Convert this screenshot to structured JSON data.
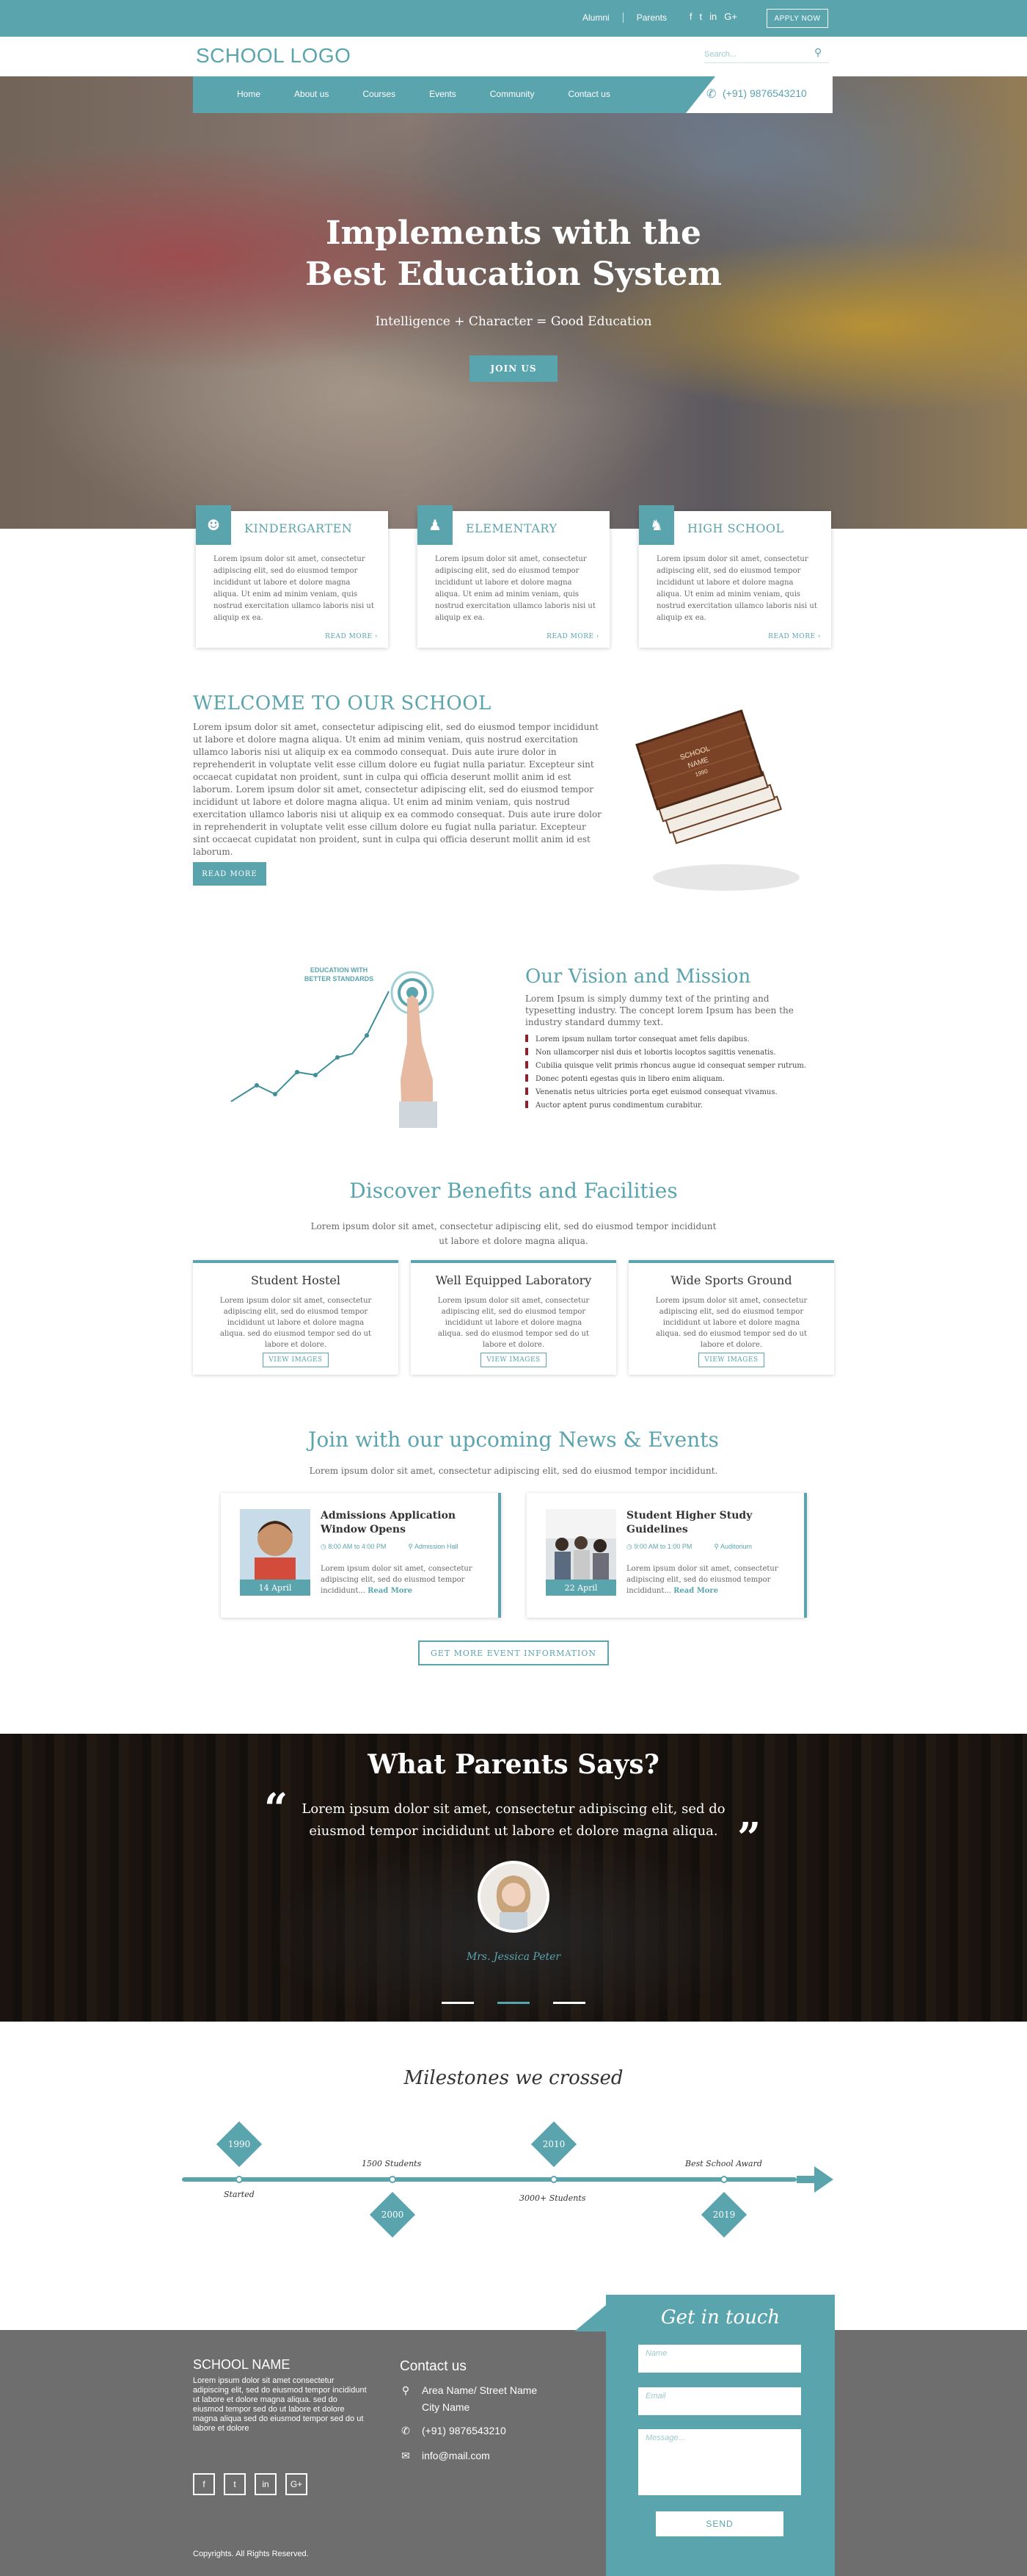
{
  "topbar": {
    "links": [
      "Alumni",
      "Parents"
    ],
    "social": [
      "f",
      "t",
      "in",
      "G+"
    ],
    "apply_label": "APPLY NOW"
  },
  "header": {
    "logo": "SCHOOL LOGO",
    "search_placeholder": "Search..."
  },
  "nav": {
    "items": [
      "Home",
      "About us",
      "Courses",
      "Events",
      "Community",
      "Contact us"
    ],
    "phone": "(+91) 9876543210"
  },
  "hero": {
    "title_line1": "Implements with the",
    "title_line2": "Best Education System",
    "subtitle": "Intelligence + Character = Good Education",
    "button": "JOIN US"
  },
  "levels": [
    {
      "title": "KINDERGARTEN",
      "desc": "Lorem ipsum dolor sit amet, consectetur adipiscing elit, sed do eiusmod tempor incididunt ut labore et dolore magna aliqua. Ut enim ad minim veniam, quis nostrud exercitation ullamco laboris nisi ut aliquip ex ea.",
      "more": "READ MORE ›"
    },
    {
      "title": "ELEMENTARY",
      "desc": "Lorem ipsum dolor sit amet, consectetur adipiscing elit, sed do eiusmod tempor incididunt ut labore et dolore magna aliqua. Ut enim ad minim veniam, quis nostrud exercitation ullamco laboris nisi ut aliquip ex ea.",
      "more": "READ MORE ›"
    },
    {
      "title": "HIGH SCHOOL",
      "desc": "Lorem ipsum dolor sit amet, consectetur adipiscing elit, sed do eiusmod tempor incididunt ut labore et dolore magna aliqua. Ut enim ad minim veniam, quis nostrud exercitation ullamco laboris nisi ut aliquip ex ea.",
      "more": "READ MORE ›"
    }
  ],
  "welcome": {
    "title": "WELCOME TO OUR SCHOOL",
    "text": "Lorem ipsum dolor sit amet, consectetur adipiscing elit, sed do eiusmod tempor incididunt ut labore et dolore magna aliqua. Ut enim ad minim veniam, quis nostrud exercitation ullamco laboris nisi ut aliquip ex ea commodo consequat. Duis aute irure dolor in reprehenderit in voluptate velit esse cillum dolore eu fugiat nulla pariatur. Excepteur sint occaecat cupidatat non proident, sunt in culpa qui officia deserunt mollit anim id est laborum. Lorem ipsum dolor sit amet, consectetur adipiscing elit, sed do eiusmod tempor incididunt ut labore et dolore magna aliqua. Ut enim ad minim veniam, quis nostrud exercitation ullamco laboris nisi ut aliquip ex ea commodo consequat. Duis aute irure dolor in reprehenderit in voluptate velit esse cillum dolore eu fugiat nulla pariatur. Excepteur sint occaecat cupidatat non proident, sunt in culpa qui officia deserunt mollit anim id est laborum.",
    "button": "READ MORE",
    "book_label_1": "SCHOOL",
    "book_label_2": "NAME",
    "book_label_3": "1990"
  },
  "vision": {
    "badge_1": "EDUCATION WITH",
    "badge_2": "BETTER STANDARDS",
    "title": "Our Vision and Mission",
    "text": "Lorem Ipsum is simply dummy text of the printing and typesetting industry. The concept lorem Ipsum has been the industry standard dummy text.",
    "list": [
      "Lorem ipsum nullam tortor consequat amet felis dapibus.",
      "Non ullamcorper nisl duis et lobortis locoptos sagittis venenatis.",
      "Cubilia quisque velit primis rhoncus augue id consequat semper rutrum.",
      "Donec potenti egestas quis in libero enim aliquam.",
      "Venenatis netus ultricies porta eget euismod consequat vivamus.",
      "Auctor aptent purus condimentum curabitur."
    ]
  },
  "benefits": {
    "title": "Discover Benefits and Facilities",
    "desc": "Lorem ipsum dolor sit amet, consectetur adipiscing elit, sed do eiusmod tempor incididunt ut labore et dolore magna aliqua.",
    "cards": [
      {
        "title": "Student Hostel",
        "desc": "Lorem ipsum dolor sit amet, consectetur adipiscing elit, sed do eiusmod tempor incididunt ut labore et dolore magna aliqua. sed do eiusmod tempor sed do ut labore et dolore.",
        "button": "VIEW IMAGES"
      },
      {
        "title": "Well Equipped Laboratory",
        "desc": "Lorem ipsum dolor sit amet, consectetur adipiscing elit, sed do eiusmod tempor incididunt ut labore et dolore magna aliqua. sed do eiusmod tempor sed do ut labore et dolore.",
        "button": "VIEW IMAGES"
      },
      {
        "title": "Wide Sports Ground",
        "desc": "Lorem ipsum dolor sit amet, consectetur adipiscing elit, sed do eiusmod tempor incididunt ut labore et dolore magna aliqua. sed do eiusmod tempor sed do ut labore et dolore.",
        "button": "VIEW IMAGES"
      }
    ]
  },
  "news": {
    "title": "Join with our upcoming News & Events",
    "desc": "Lorem ipsum dolor sit amet, consectetur adipiscing elit, sed do eiusmod tempor incididunt.",
    "cards": [
      {
        "title": "Admissions Application Window Opens",
        "time": "8:00 AM to 4:00 PM",
        "place": "Admission Hall",
        "desc": "Lorem ipsum dolor sit amet, consectetur adipiscing elit, sed do eiusmod tempor incididunt...",
        "more": "Read More",
        "date": "14 April"
      },
      {
        "title": "Student Higher Study Guidelines",
        "time": "9:00 AM to 1:00 PM",
        "place": "Auditorium",
        "desc": "Lorem ipsum dolor sit amet, consectetur adipiscing elit, sed do eiusmod tempor incididunt...",
        "more": "Read More",
        "date": "22 April"
      }
    ],
    "button": "GET MORE EVENT INFORMATION"
  },
  "testimonial": {
    "title": "What Parents Says?",
    "quote": "Lorem ipsum dolor sit amet, consectetur adipiscing elit, sed do eiusmod tempor incididunt ut labore et dolore magna aliqua.",
    "name": "Mrs. Jessica Peter"
  },
  "milestones": {
    "title": "Milestones we crossed",
    "years": [
      "1990",
      "2000",
      "2010",
      "2019"
    ],
    "labels": [
      "Started",
      "1500 Students",
      "3000+ Students",
      "Best School Award"
    ]
  },
  "footer": {
    "school_name": "SCHOOL NAME",
    "desc": "Lorem ipsum dolor sit amet consectetur adipiscing elit, sed do eiusmod tempor incididunt ut labore et dolore magna aliqua. sed do eiusmod tempor sed do ut labore et dolore magna aliqua sed do eiusmod tempor sed do ut labore et dolore",
    "social": [
      "f",
      "t",
      "in",
      "G+"
    ],
    "copyright": "Copyrights. All Rights Reserved.",
    "contact_title": "Contact us",
    "address_line1": "Area Name/ Street Name",
    "address_line2": "City Name",
    "phone": "(+91) 9876543210",
    "email": "info@mail.com"
  },
  "contact_form": {
    "title": "Get in touch",
    "name_placeholder": "Name",
    "email_placeholder": "Email",
    "message_placeholder": "Message...",
    "send": "SEND"
  },
  "colors": {
    "accent": "#5aa4ad",
    "footer": "#6e6e6e",
    "bullet": "#8b2230"
  }
}
